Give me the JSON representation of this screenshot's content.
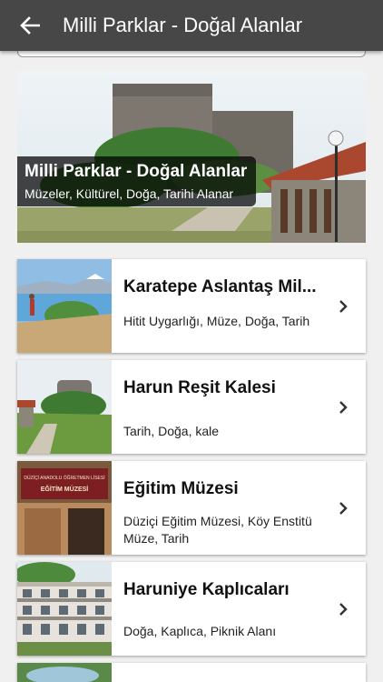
{
  "appbar": {
    "title": "Milli Parklar - Doğal Alanlar",
    "back_icon": "arrow-left-icon"
  },
  "hero": {
    "title": "Milli Parklar - Doğal Alanlar",
    "subtitle": "Müzeler, Kültürel, Doğa, Tarihi Alanar"
  },
  "items": [
    {
      "title": "Karatepe Aslantaş Mil...",
      "subtitle": "Hitit Uygarlığı, Müze, Doğa, Tarih"
    },
    {
      "title": "Harun Reşit Kalesi",
      "subtitle": "Tarih, Doğa, kale"
    },
    {
      "title": "Eğitim Müzesi",
      "subtitle": "Düziçi Eğitim Müzesi, Köy Enstitü Müze, Tarih",
      "thumb_sign": [
        "DÜZİÇİ ANADOLU ÖĞRETMEN LİSESİ",
        "EĞİTİM MÜZESİ"
      ]
    },
    {
      "title": "Haruniye Kaplıcaları",
      "subtitle": "Doğa, Kaplıca, Piknik Alanı"
    }
  ],
  "icons": {
    "chevron": "chevron-right-icon"
  }
}
